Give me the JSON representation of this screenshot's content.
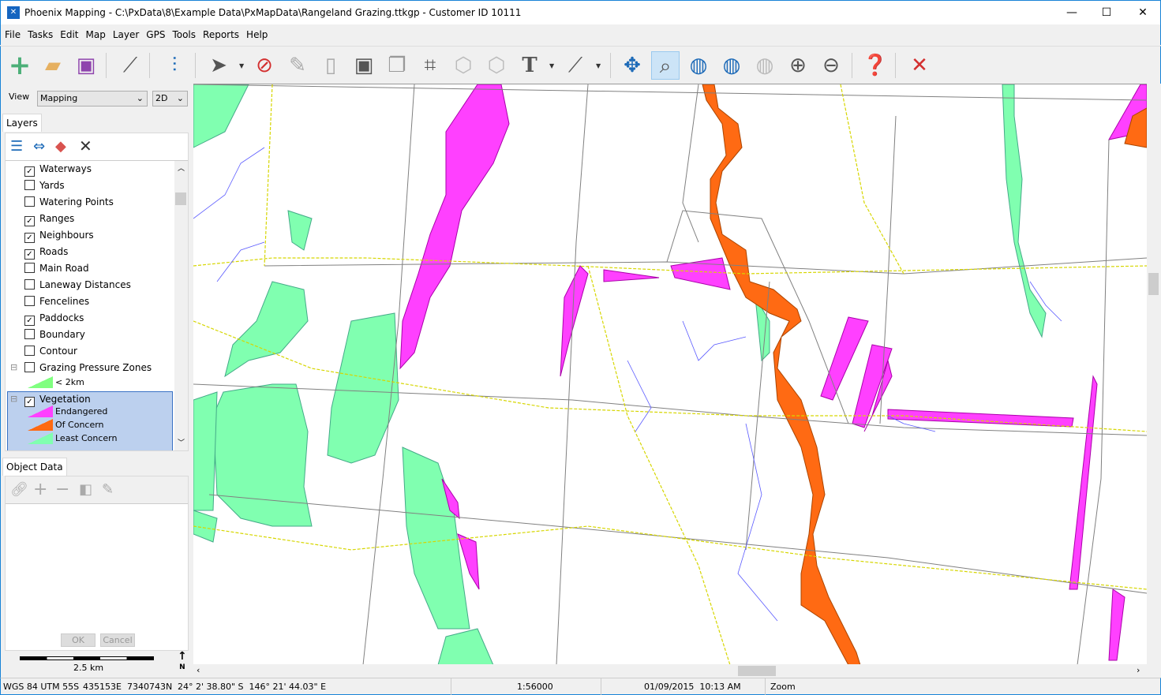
{
  "window": {
    "title": "Phoenix Mapping - C:\\PxData\\8\\Example Data\\PxMapData\\Rangeland Grazing.ttkgp - Customer ID 10111",
    "minimize": "—",
    "maximize": "☐",
    "close": "✕"
  },
  "menu": [
    "File",
    "Tasks",
    "Edit",
    "Map",
    "Layer",
    "GPS",
    "Tools",
    "Reports",
    "Help"
  ],
  "toolbar": {
    "icons": [
      "new-icon",
      "open-icon",
      "save-icon",
      "magic-wand-icon",
      "sliders-icon",
      "select-arrow-icon",
      "deselect-icon",
      "pencil-icon",
      "edit-document-icon",
      "frame-icon",
      "copy-icon",
      "crop-icon",
      "hex-split-icon",
      "hex-merge-icon",
      "text-icon",
      "ruler-icon",
      "pan-icon",
      "zoom-box-icon",
      "globe-icon",
      "globe-refresh-icon",
      "globe-disabled-icon",
      "zoom-in-icon",
      "zoom-out-icon",
      "help-icon",
      "close-icon"
    ],
    "accent_close": "#d32f2f"
  },
  "view": {
    "label": "View",
    "mode": "Mapping",
    "dimension": "2D"
  },
  "layers": {
    "tab": "Layers",
    "items": [
      {
        "label": "Waterways",
        "checked": true
      },
      {
        "label": "Yards",
        "checked": false
      },
      {
        "label": "Watering Points",
        "checked": false
      },
      {
        "label": "Ranges",
        "checked": true
      },
      {
        "label": "Neighbours",
        "checked": true
      },
      {
        "label": "Roads",
        "checked": true
      },
      {
        "label": "Main Road",
        "checked": false
      },
      {
        "label": "Laneway Distances",
        "checked": false
      },
      {
        "label": "Fencelines",
        "checked": false
      },
      {
        "label": "Paddocks",
        "checked": true
      },
      {
        "label": "Boundary",
        "checked": false
      },
      {
        "label": "Contour",
        "checked": false
      },
      {
        "label": "Grazing Pressure Zones",
        "checked": false,
        "expanded": true
      }
    ],
    "gpz_legend": [
      {
        "label": "< 2km",
        "color": "#80ff80"
      }
    ],
    "vegetation": {
      "label": "Vegetation",
      "checked": true,
      "selected": true,
      "legend": [
        {
          "label": "Endangered",
          "color": "#ff40ff"
        },
        {
          "label": "Of Concern",
          "color": "#ff6a13"
        },
        {
          "label": "Least Concern",
          "color": "#80ffb0"
        }
      ]
    }
  },
  "object_data": {
    "tab": "Object Data",
    "ok": "OK",
    "cancel": "Cancel"
  },
  "scale_bar": {
    "label": "2.5 km",
    "north": "N"
  },
  "status": {
    "crs": "WGS 84 UTM 55S",
    "easting": "435153E",
    "northing": "7340743N",
    "latlon": "24° 2' 38.80\" S  146° 21' 44.03\" E",
    "scale": "1:56000",
    "datetime": "01/09/2015  10:13 AM",
    "mode": "Zoom"
  },
  "colors": {
    "endangered": "#ff40ff",
    "of_concern": "#ff6a13",
    "least_concern": "#80ffb0",
    "waterway": "#5a5aff",
    "road": "#d6d600",
    "paddock": "#808080"
  }
}
